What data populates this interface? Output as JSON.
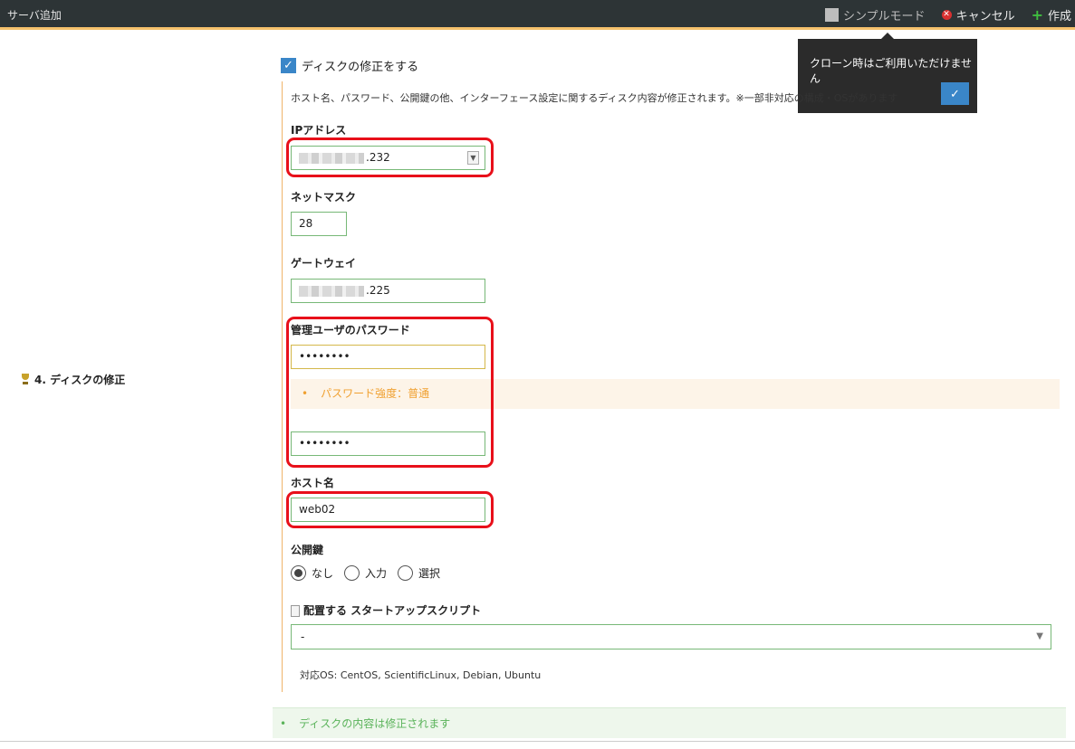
{
  "header": {
    "title": "サーバ追加",
    "simple_mode_label": "シンプルモード",
    "cancel_label": "キャンセル",
    "create_label": "作成"
  },
  "tooltip": {
    "message": "クローン時はご利用いただけません",
    "ok_label": "✓"
  },
  "section": {
    "title": "4. ディスクの修正"
  },
  "disk_edit": {
    "checkbox_label": "ディスクの修正をする",
    "checked": true,
    "description": "ホスト名、パスワード、公開鍵の他、インターフェース設定に関するディスク内容が修正されます。※一部非対応の構成・OSがあります"
  },
  "fields": {
    "ip_label": "IPアドレス",
    "ip_value_suffix": ".232",
    "netmask_label": "ネットマスク",
    "netmask_value": "28",
    "gateway_label": "ゲートウェイ",
    "gateway_value_suffix": ".225",
    "password_label": "管理ユーザのパスワード",
    "password_value": "••••••••",
    "password_strength": "パスワード強度：普通",
    "password_confirm_value": "••••••••",
    "hostname_label": "ホスト名",
    "hostname_value": "web02",
    "pubkey_label": "公開鍵",
    "pubkey_options": [
      "なし",
      "入力",
      "選択"
    ],
    "pubkey_selected": "なし",
    "startup_label": "配置する スタートアップスクリプト",
    "startup_value": "-",
    "startup_support": "対応OS: CentOS, ScientificLinux, Debian, Ubuntu"
  },
  "footer_note": "ディスクの内容は修正されます",
  "colors": {
    "topbar_bg": "#2d3436",
    "accent_orange": "#f5c16c",
    "highlight_red": "#e8101a",
    "field_border_green": "#77b877",
    "check_blue": "#3a86c8"
  }
}
